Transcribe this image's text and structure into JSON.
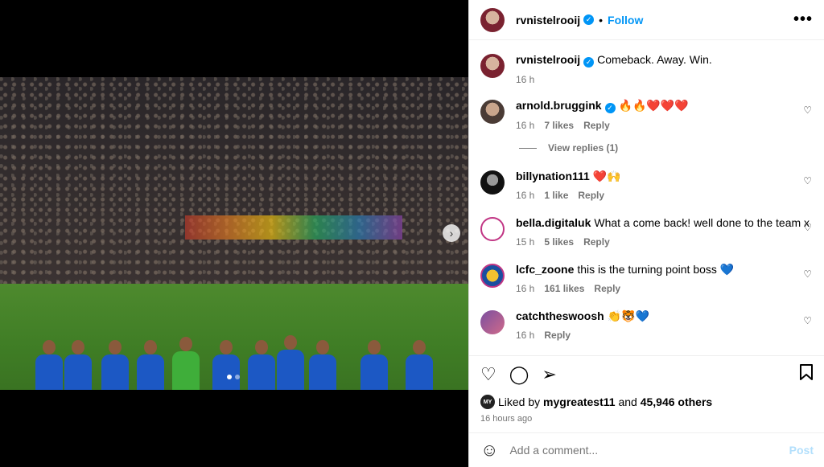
{
  "post": {
    "username": "rvnistelrooij",
    "follow_label": "Follow",
    "more_label": "•••",
    "caption": "Comeback. Away. Win.",
    "caption_time": "16 h"
  },
  "comments": [
    {
      "user": "arnold.bruggink",
      "verified": true,
      "text": "🔥🔥❤️❤️❤️",
      "time": "16 h",
      "likes": "7 likes",
      "reply": "Reply",
      "view_replies": "View replies (1)"
    },
    {
      "user": "billynation111",
      "verified": false,
      "text": "❤️🙌",
      "time": "16 h",
      "likes": "1 like",
      "reply": "Reply"
    },
    {
      "user": "bella.digitaluk",
      "verified": false,
      "text": "What a come back! well done to the team x",
      "time": "15 h",
      "likes": "5 likes",
      "reply": "Reply"
    },
    {
      "user": "lcfc_zoone",
      "verified": false,
      "text": "this is the turning point boss 💙",
      "time": "16 h",
      "likes": "161 likes",
      "reply": "Reply"
    },
    {
      "user": "catchtheswoosh",
      "verified": false,
      "text": "👏🐯💙",
      "time": "16 h",
      "likes": "",
      "reply": "Reply"
    }
  ],
  "likes": {
    "prefix": "Liked by",
    "user": "mygreatest11",
    "and": "and",
    "others": "45,946 others",
    "mini_avatar": "MY",
    "ago": "16 hours ago"
  },
  "add_comment": {
    "placeholder": "Add a comment...",
    "post_label": "Post"
  },
  "colors": {
    "accent": "#0095f6",
    "post_disabled": "#b2dffc",
    "kit": "#1c58c4",
    "gk_kit": "#3fae3a"
  }
}
